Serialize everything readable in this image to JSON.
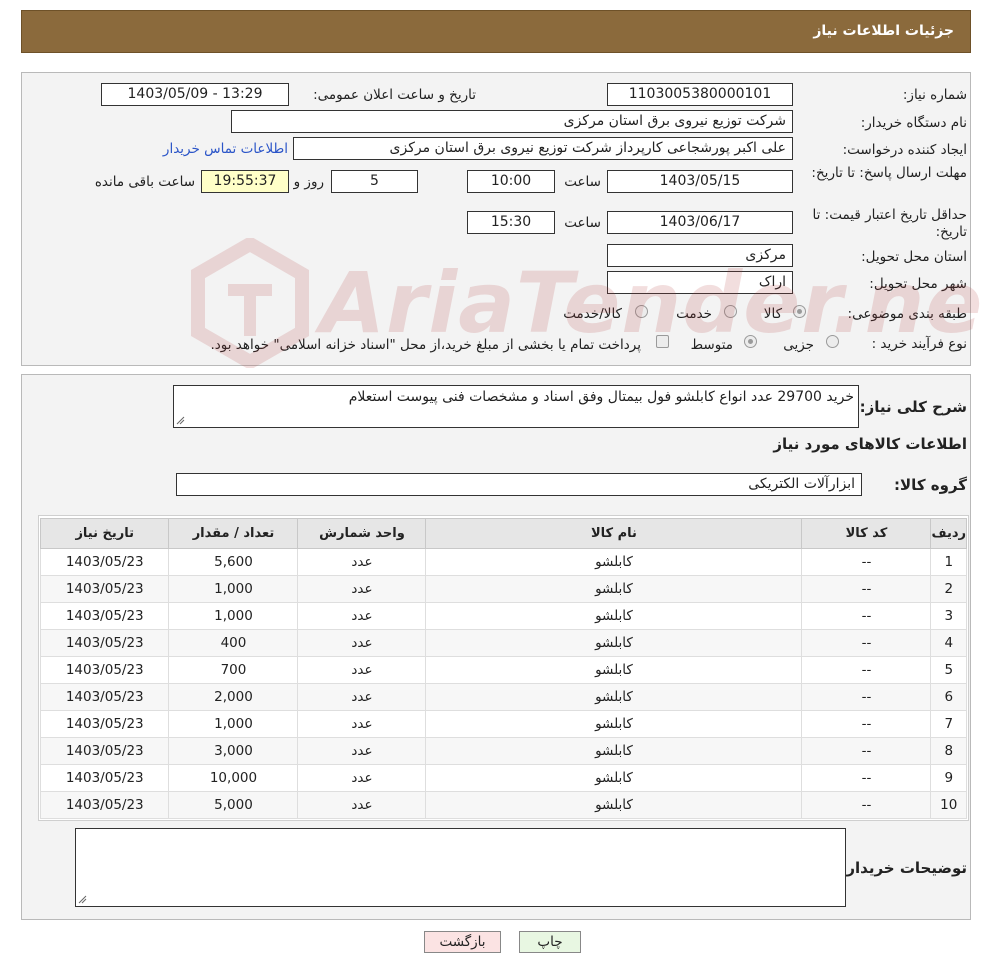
{
  "header": {
    "title": "جزئیات اطلاعات نیاز"
  },
  "form": {
    "need_number_label": "شماره نیاز:",
    "need_number": "1103005380000101",
    "announce_label": "تاریخ و ساعت اعلان عمومی:",
    "announce_value": "1403/05/09 - 13:29",
    "buyer_org_label": "نام دستگاه خریدار:",
    "buyer_org": "شرکت توزیع نیروی برق استان مرکزی",
    "requester_label": "ایجاد کننده درخواست:",
    "requester": "علی اکبر پورشجاعی کارپرداز شرکت توزیع نیروی برق استان مرکزی",
    "contact_link": "اطلاعات تماس خریدار",
    "deadline_label": "مهلت ارسال پاسخ: تا تاریخ:",
    "deadline_date": "1403/05/15",
    "time_label": "ساعت",
    "deadline_time": "10:00",
    "days_value": "5",
    "days_label": "روز و",
    "remaining_time": "19:55:37",
    "remaining_label": "ساعت باقی مانده",
    "validity_label": "حداقل تاریخ اعتبار قیمت: تا تاریخ:",
    "validity_date": "1403/06/17",
    "validity_time": "15:30",
    "province_label": "استان محل تحویل:",
    "province": "مرکزی",
    "city_label": "شهر محل تحویل:",
    "city": "اراک",
    "category_label": "طبقه بندی موضوعی:",
    "category_options": [
      "کالا",
      "خدمت",
      "کالا/خدمت"
    ],
    "process_label": "نوع فرآیند خرید :",
    "process_options": [
      "جزیی",
      "متوسط"
    ],
    "payment_note": "پرداخت تمام یا بخشی از مبلغ خرید،از محل \"اسناد خزانه اسلامی\" خواهد بود."
  },
  "watermark": "AriaTender.neT",
  "summary": {
    "label": "شرح کلی نیاز:",
    "text": "خرید 29700 عدد انواع کابلشو فول بیمتال وفق اسناد و مشخصات فنی پیوست استعلام"
  },
  "goods": {
    "section_title": "اطلاعات کالاهای مورد نیاز",
    "group_label": "گروه کالا:",
    "group_value": "ابزارآلات الکتریکی",
    "columns": [
      "ردیف",
      "کد کالا",
      "نام کالا",
      "واحد شمارش",
      "تعداد / مقدار",
      "تاریخ نیاز"
    ],
    "rows": [
      [
        "1",
        "--",
        "کابلشو",
        "عدد",
        "5,600",
        "1403/05/23"
      ],
      [
        "2",
        "--",
        "کابلشو",
        "عدد",
        "1,000",
        "1403/05/23"
      ],
      [
        "3",
        "--",
        "کابلشو",
        "عدد",
        "1,000",
        "1403/05/23"
      ],
      [
        "4",
        "--",
        "کابلشو",
        "عدد",
        "400",
        "1403/05/23"
      ],
      [
        "5",
        "--",
        "کابلشو",
        "عدد",
        "700",
        "1403/05/23"
      ],
      [
        "6",
        "--",
        "کابلشو",
        "عدد",
        "2,000",
        "1403/05/23"
      ],
      [
        "7",
        "--",
        "کابلشو",
        "عدد",
        "1,000",
        "1403/05/23"
      ],
      [
        "8",
        "--",
        "کابلشو",
        "عدد",
        "3,000",
        "1403/05/23"
      ],
      [
        "9",
        "--",
        "کابلشو",
        "عدد",
        "10,000",
        "1403/05/23"
      ],
      [
        "10",
        "--",
        "کابلشو",
        "عدد",
        "5,000",
        "1403/05/23"
      ]
    ]
  },
  "buyer_notes": {
    "label": "توضیحات خریدار:",
    "value": ""
  },
  "buttons": {
    "print": "چاپ",
    "back": "بازگشت"
  },
  "colors": {
    "header_bg": "#8b6a3c",
    "link": "#2b55c8",
    "print_btn": "#e8f7e2",
    "back_btn": "#fbe3e3",
    "remaining_bg": "#ffffc8"
  }
}
